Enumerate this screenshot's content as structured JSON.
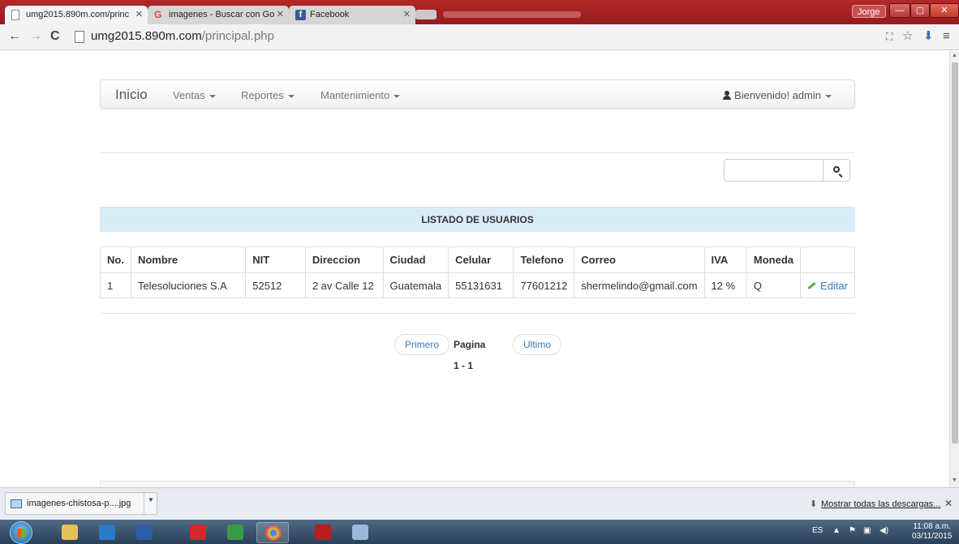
{
  "browser": {
    "tabs": [
      {
        "label": "umg2015.890m.com/princ",
        "icon": "page-icon"
      },
      {
        "label": "imagenes - Buscar con Go",
        "icon": "google-icon"
      },
      {
        "label": "Facebook",
        "icon": "facebook-icon"
      }
    ],
    "user_chip": "Jorge",
    "url_host": "umg2015.890m.com",
    "url_path": "/principal.php"
  },
  "navbar": {
    "brand": "Inicio",
    "menus": [
      "Ventas",
      "Reportes",
      "Mantenimiento"
    ],
    "user_menu": "Bienvenido! admin"
  },
  "search": {
    "placeholder": "",
    "value": ""
  },
  "listado": {
    "title": "LISTADO DE USUARIOS",
    "columns": [
      "No.",
      "Nombre",
      "NIT",
      "Direccion",
      "Ciudad",
      "Celular",
      "Telefono",
      "Correo",
      "IVA",
      "Moneda",
      ""
    ],
    "rows": [
      {
        "no": "1",
        "nombre": "Telesoluciones S.A",
        "nit": "52512",
        "direccion": "2 av Calle 12",
        "ciudad": "Guatemala",
        "celular": "55131631",
        "telefono": "77601212",
        "correo": "shermelindo@gmail.com",
        "iva": "12 %",
        "moneda": "Q",
        "action": "Editar"
      }
    ]
  },
  "pagination": {
    "first": "Primero",
    "info": "Pagina 1 - 1",
    "last": "Ultimo"
  },
  "downloads": {
    "file": "imagenes-chistosa-p....jpg",
    "show_all": "Mostrar todas las descargas..."
  },
  "taskbar": {
    "lang": "ES",
    "time": "11:08 a.m.",
    "date": "03/11/2015"
  },
  "colors": {
    "panel_heading": "#d9edf7",
    "link": "#337ab7",
    "titlebar": "#a82222"
  }
}
